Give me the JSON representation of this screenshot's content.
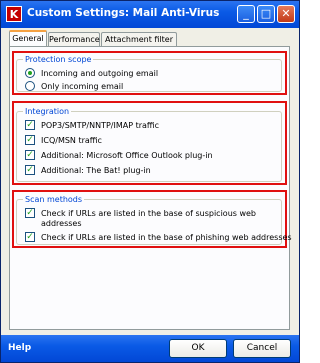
{
  "window": {
    "title": "Custom Settings: Mail Anti-Virus",
    "app_icon_letter": "K",
    "minimize_glyph": "_",
    "maximize_glyph": "□",
    "close_glyph": "✕"
  },
  "tabs": [
    {
      "label": "General",
      "active": true
    },
    {
      "label": "Performance",
      "active": false
    },
    {
      "label": "Attachment filter",
      "active": false
    }
  ],
  "protection_scope": {
    "legend": "Protection scope",
    "options": [
      {
        "label": "Incoming and outgoing email",
        "selected": true
      },
      {
        "label": "Only incoming email",
        "selected": false
      }
    ]
  },
  "integration": {
    "legend": "Integration",
    "items": [
      {
        "label": "POP3/SMTP/NNTP/IMAP traffic",
        "checked": true
      },
      {
        "label": "ICQ/MSN traffic",
        "checked": true
      },
      {
        "label": "Additional: Microsoft Office Outlook plug-in",
        "checked": true
      },
      {
        "label": "Additional: The Bat! plug-in",
        "checked": true
      }
    ]
  },
  "scan_methods": {
    "legend": "Scan methods",
    "items": [
      {
        "label_line1": "Check if URLs are listed in the base of suspicious web",
        "label_line2": "addresses",
        "checked": true
      },
      {
        "label_line1": "Check if URLs are listed in the base of phishing web addresses",
        "checked": true
      }
    ]
  },
  "footer": {
    "help": "Help",
    "ok": "OK",
    "cancel": "Cancel"
  },
  "check_glyph": "✓"
}
